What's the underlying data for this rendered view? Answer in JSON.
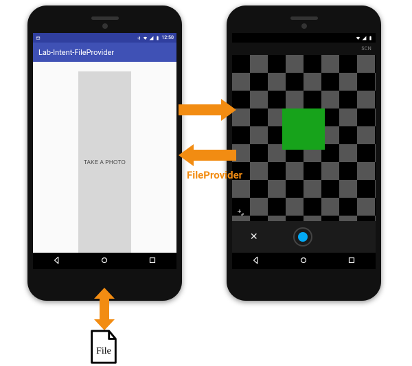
{
  "statusbar_time": "12:50",
  "left_phone": {
    "app_title": "Lab-Intent-FileProvider",
    "take_photo_label": "TAKE A PHOTO"
  },
  "right_phone": {
    "cam_mode_label": "SCN",
    "cancel_symbol": "✕"
  },
  "labels": {
    "file_provider": "FileProvider",
    "file": "File"
  },
  "colors": {
    "arrow": "#f28c12",
    "appbar": "#3F51B5",
    "status_accent": "#303F9F",
    "shutter": "#03A9F4",
    "green_target": "#17a31b"
  }
}
